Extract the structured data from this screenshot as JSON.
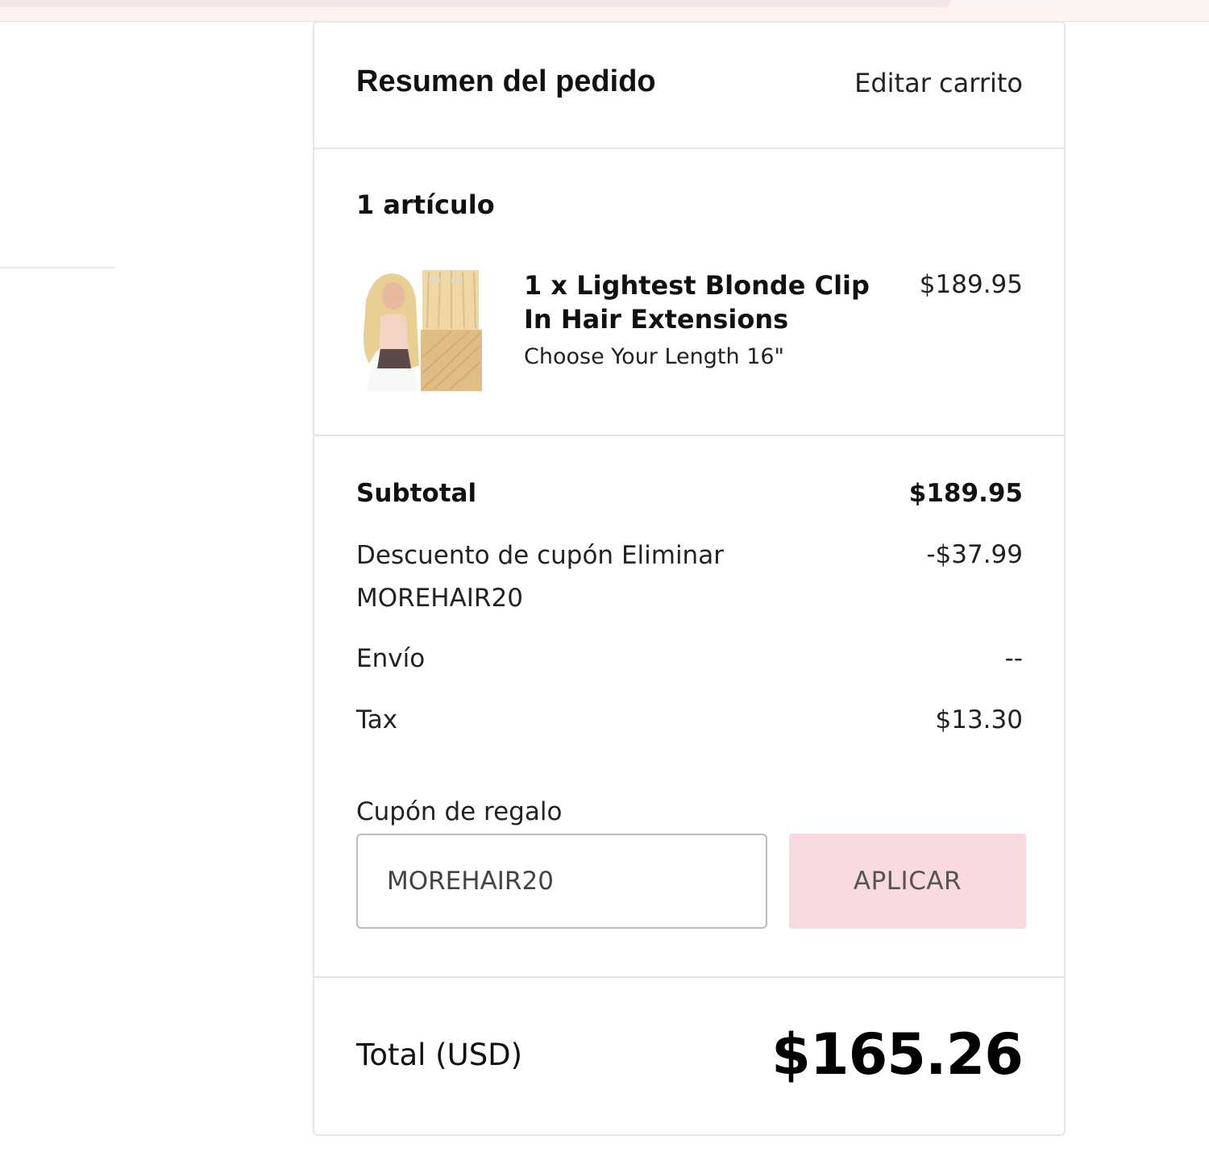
{
  "summary": {
    "title": "Resumen del pedido",
    "edit_cart": "Editar carrito",
    "items_count": "1 artículo",
    "items": [
      {
        "name": "1 x Lightest Blonde Clip In Hair Extensions",
        "variant": "Choose Your Length 16\"",
        "price": "$189.95",
        "image_icon": "product-thumbnail"
      }
    ],
    "totals": {
      "subtotal_label": "Subtotal",
      "subtotal_value": "$189.95",
      "discount_label": "Descuento de cupón",
      "discount_remove": "Eliminar",
      "discount_code": "MOREHAIR20",
      "discount_value": "-$37.99",
      "shipping_label": "Envío",
      "shipping_value": "--",
      "tax_label": "Tax",
      "tax_value": "$13.30"
    },
    "gift": {
      "label": "Cupón de regalo",
      "input_value": "MOREHAIR20",
      "apply_label": "APLICAR"
    },
    "grand_total": {
      "label": "Total (USD)",
      "value": "$165.26"
    }
  },
  "colors": {
    "accent_button": "#f8d9de",
    "border": "#e6e6e6",
    "top_strip": "#fdf4f2"
  }
}
